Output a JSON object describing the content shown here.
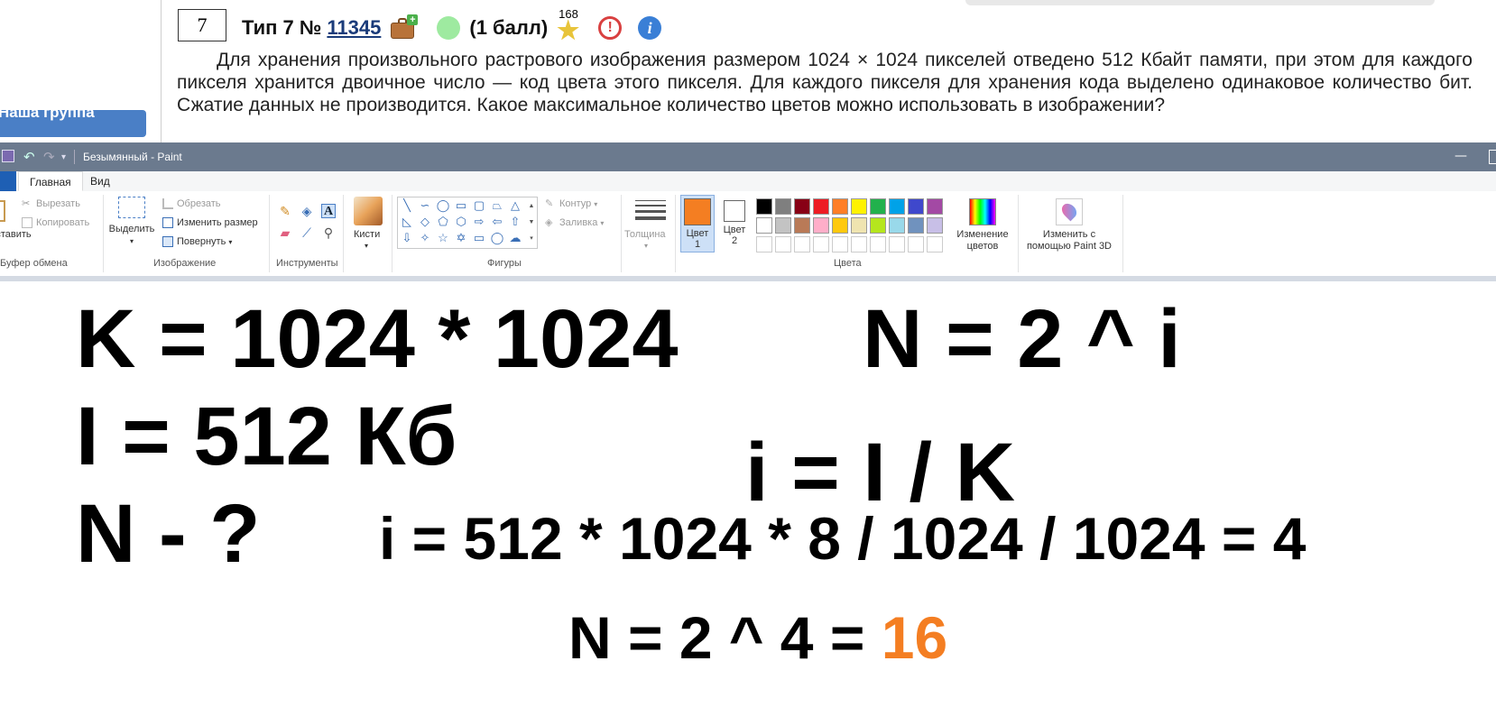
{
  "web": {
    "sidebar_button": "Наша группа",
    "task_number": "7",
    "task_type": "Тип 7 №",
    "task_id": "11345",
    "score": "(1 балл)",
    "star_count": "168",
    "task_text": "Для хранения произвольного растрового изображения размером 1024 × 1024 пикселей отведено 512 Кбайт памяти, при этом для каждого пикселя хранится двоичное число — код цвета этого пикселя. Для каждого пикселя для хранения кода выделено одинаковое количество бит. Сжатие данных не производится. Какое максимальное количество цветов можно использовать в изображении?"
  },
  "paint": {
    "window_title": "Безымянный - Paint",
    "minimize_glyph": "—",
    "tabs": {
      "file": "Ф",
      "home": "Главная",
      "view": "Вид"
    },
    "clipboard": {
      "paste_label": "Вставить",
      "cut": "Вырезать",
      "copy": "Копировать",
      "group": "Буфер обмена"
    },
    "image": {
      "select": "Выделить",
      "crop": "Обрезать",
      "resize": "Изменить размер",
      "rotate": "Повернуть",
      "group": "Изображение"
    },
    "tools": {
      "group": "Инструменты",
      "brushes": "Кисти"
    },
    "shapes": {
      "outline": "Контур",
      "fill": "Заливка",
      "group": "Фигуры"
    },
    "size": {
      "label": "Толщина"
    },
    "colors": {
      "color1_label": "Цвет",
      "color1_num": "1",
      "color2_label": "Цвет",
      "color2_num": "2",
      "edit_colors_line1": "Изменение",
      "edit_colors_line2": "цветов",
      "group": "Цвета",
      "color1": "#f47e22",
      "color2": "#ffffff",
      "palette_row1": [
        "#000000",
        "#7f7f7f",
        "#880015",
        "#ed1c24",
        "#ff7f27",
        "#fff200",
        "#22b14c",
        "#00a2e8",
        "#3f48cc",
        "#a349a4"
      ],
      "palette_row2": [
        "#ffffff",
        "#c3c3c3",
        "#b97a57",
        "#ffaec9",
        "#ffc90e",
        "#efe4b0",
        "#b5e61d",
        "#99d9ea",
        "#7092be",
        "#c8bfe7"
      ],
      "palette_row3": [
        "#ffffff",
        "#ffffff",
        "#ffffff",
        "#ffffff",
        "#ffffff",
        "#ffffff",
        "#ffffff",
        "#ffffff",
        "#ffffff",
        "#ffffff"
      ]
    },
    "paint3d": {
      "line1": "Изменить с",
      "line2": "помощью Paint 3D"
    }
  },
  "canvas": {
    "k_formula": "K = 1024 * 1024",
    "n_formula": "N = 2 ^ i",
    "i_given": "I = 512 Кб",
    "i_formula": "i = I / K",
    "n_unknown": "N - ?",
    "i_calc": "i = 512 * 1024 * 8 / 1024 / 1024 = 4",
    "n_calc_prefix": "N = 2 ^ 4 = ",
    "n_answer": "16",
    "answer_color": "#f47e22"
  }
}
